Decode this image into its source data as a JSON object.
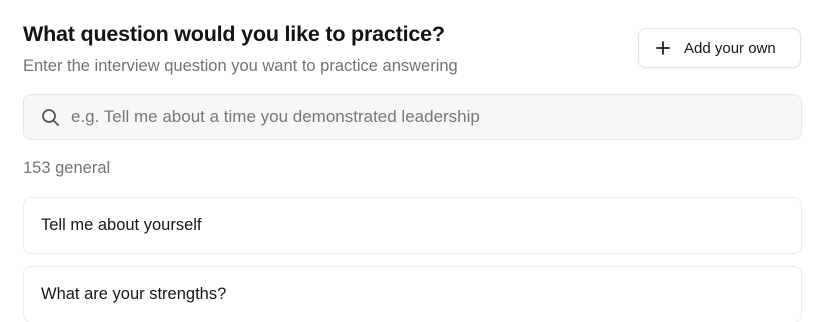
{
  "header": {
    "title": "What question would you like to practice?",
    "subtitle": "Enter the interview question you want to practice answering"
  },
  "add_button": {
    "label": "Add your own",
    "icon": "plus-icon"
  },
  "search": {
    "icon": "search-icon",
    "placeholder": "e.g. Tell me about a time you demonstrated leadership",
    "value": ""
  },
  "questions": {
    "count_label": "153 general",
    "items": [
      {
        "text": "Tell me about yourself"
      },
      {
        "text": "What are your strengths?"
      }
    ]
  },
  "colors": {
    "text_primary": "#171717",
    "text_muted": "#727272",
    "search_bg": "#f7f7f7",
    "border": "#e6e6e6"
  }
}
